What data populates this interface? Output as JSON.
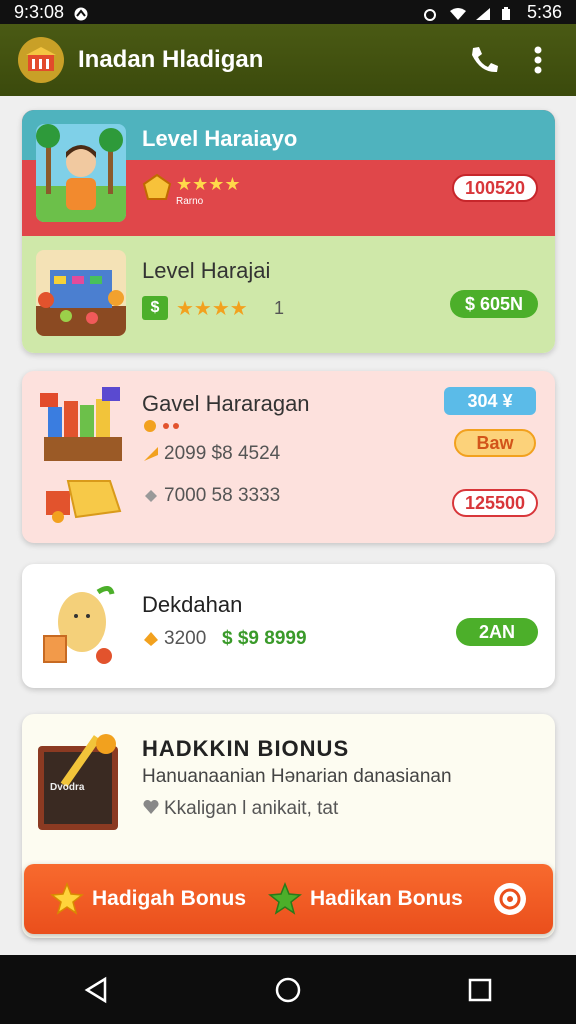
{
  "status": {
    "time": "9:3:08",
    "battery_time": "5:36"
  },
  "app": {
    "title": "Inadan Hladigan"
  },
  "card1": {
    "title": "Level Haraiayo",
    "sub_label": "Rarno",
    "stars": "★★★★",
    "value": "100520"
  },
  "card2": {
    "title": "Level Harajai",
    "stars": "★★★★",
    "count": "1",
    "badge": "$",
    "value": "$ 605N"
  },
  "card3": {
    "title": "Gavel Hararagan",
    "line1": "2099  $8 4524",
    "line2": "7000  58 3333",
    "pill_blue": "304 ¥",
    "pill_orange": "Baw",
    "pill_red": "125500"
  },
  "card4": {
    "title": "Dekdahan",
    "amount": "3200",
    "price": "$ $9 8999",
    "pill": "2AN"
  },
  "card5": {
    "title": "HADKKIN BIONUS",
    "subtitle": "Hanuanaanian Hənarian danasianan",
    "note": "Kkaligan l anikait, tat",
    "board_label": "Dvodra"
  },
  "bonus_bar": {
    "left_label": "Hadigah Bonus",
    "right_label": "Hadikan Bonus"
  },
  "colors": {
    "appbar": "#3f4e10",
    "red": "#e0474a",
    "green": "#4caf2a",
    "orange": "#f05a22"
  }
}
